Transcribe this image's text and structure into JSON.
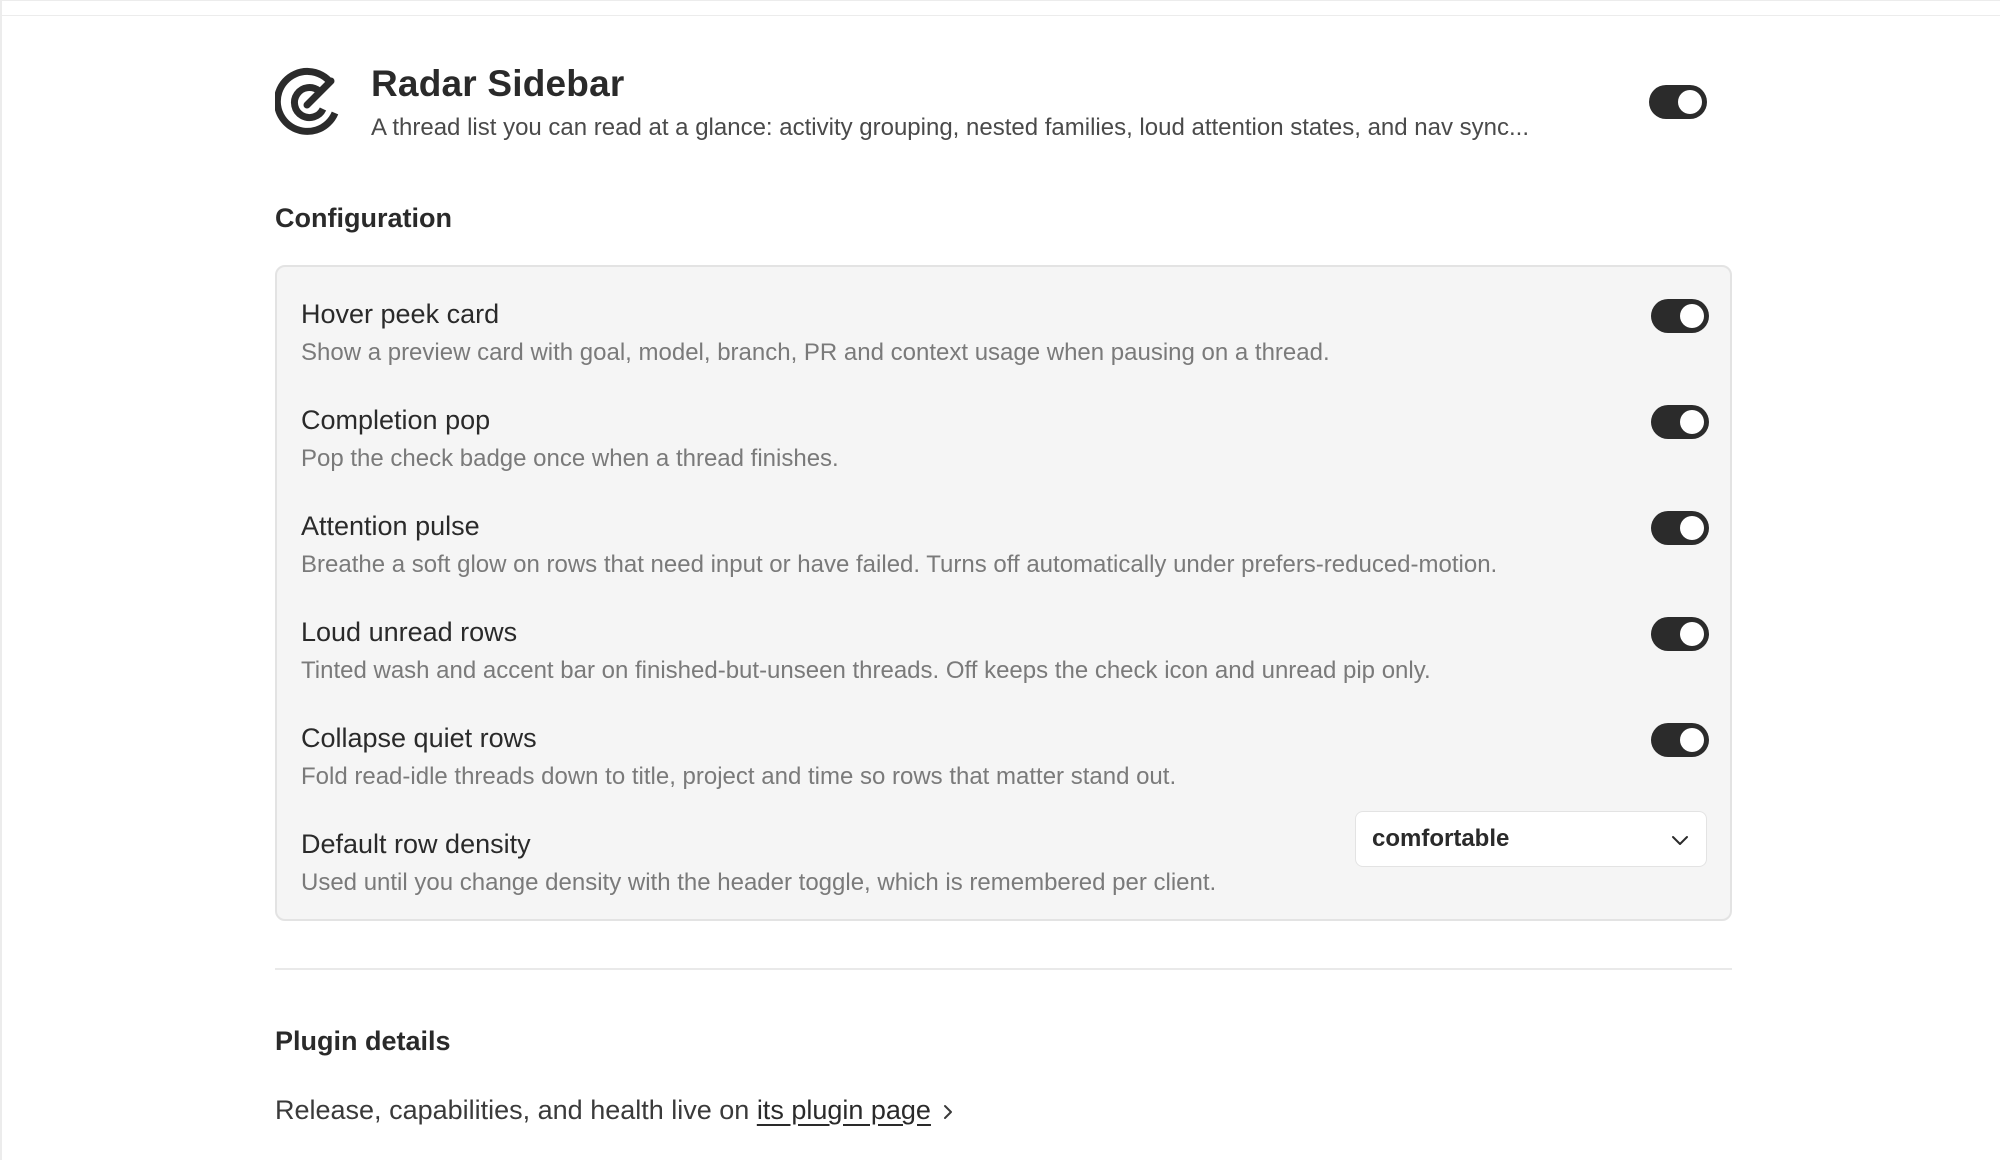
{
  "plugin": {
    "title": "Radar Sidebar",
    "description": "A thread list you can read at a glance: activity grouping, nested families, loud attention states, and nav sync...",
    "enabled": true
  },
  "configuration": {
    "heading": "Configuration",
    "settings": [
      {
        "label": "Hover peek card",
        "description": "Show a preview card with goal, model, branch, PR and context usage when pausing on a thread.",
        "enabled": true
      },
      {
        "label": "Completion pop",
        "description": "Pop the check badge once when a thread finishes.",
        "enabled": true
      },
      {
        "label": "Attention pulse",
        "description": "Breathe a soft glow on rows that need input or have failed. Turns off automatically under prefers-reduced-motion.",
        "enabled": true
      },
      {
        "label": "Loud unread rows",
        "description": "Tinted wash and accent bar on finished-but-unseen threads. Off keeps the check icon and unread pip only.",
        "enabled": true
      },
      {
        "label": "Collapse quiet rows",
        "description": "Fold read-idle threads down to title, project and time so rows that matter stand out.",
        "enabled": true
      }
    ],
    "density": {
      "label": "Default row density",
      "description": "Used until you change density with the header toggle, which is remembered per client.",
      "selected": "comfortable"
    }
  },
  "details": {
    "heading": "Plugin details",
    "text": "Release, capabilities, and health live on ",
    "link_label": "its plugin page"
  },
  "colors": {
    "toggle_on": "#2b2b2b",
    "panel_bg": "#f5f5f5",
    "muted_text": "#7a7a7a"
  },
  "icons": {
    "logo": "radar-logo-icon",
    "select_caret": "chevron-down-icon",
    "link_arrow": "chevron-right-icon"
  }
}
